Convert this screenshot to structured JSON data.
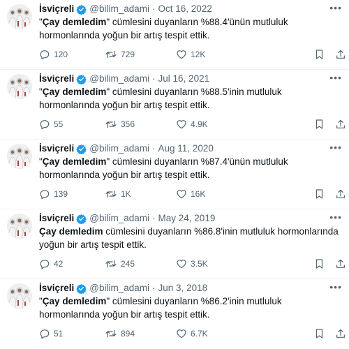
{
  "tweets": [
    {
      "author": "İsviçreli",
      "handle": "@bilim_adami",
      "separator": "·",
      "date": "Oct 16, 2022",
      "text": {
        "open_quote": "\"",
        "bold": "Çay demledim",
        "close_quote": "\"",
        "rest": " cümlesini duyanların %88.4'ünün mutluluk hormonlarında yoğun bir artış tespit ettik."
      },
      "replies": "120",
      "retweets": "729",
      "likes": "12K"
    },
    {
      "author": "İsviçreli",
      "handle": "@bilim_adami",
      "separator": "·",
      "date": "Jul 16, 2021",
      "text": {
        "open_quote": "\"",
        "bold": "Çay demledim",
        "close_quote": "\"",
        "rest": " cümlesini duyanların %88.5'inin mutluluk hormonlarında yoğun bir artış tespit ettik."
      },
      "replies": "55",
      "retweets": "356",
      "likes": "4.9K"
    },
    {
      "author": "İsviçreli",
      "handle": "@bilim_adami",
      "separator": "·",
      "date": "Aug 11, 2020",
      "text": {
        "open_quote": "\"",
        "bold": "Çay demledim",
        "close_quote": "\"",
        "rest": " cümlesini duyanların %87.4'ünün mutluluk hormonlarında yoğun bir artış tespit ettik."
      },
      "replies": "139",
      "retweets": "1K",
      "likes": "16K"
    },
    {
      "author": "İsviçreli",
      "handle": "@bilim_adami",
      "separator": "·",
      "date": "May 24, 2019",
      "text": {
        "open_quote": "",
        "bold": "Çay demledim",
        "close_quote": "",
        "rest": " cümlesini duyanların %86.8'inin mutluluk hormonlarında yoğun bir artış tespit ettik."
      },
      "replies": "42",
      "retweets": "245",
      "likes": "3.5K"
    },
    {
      "author": "İsviçreli",
      "handle": "@bilim_adami",
      "separator": "·",
      "date": "Jun 3, 2018",
      "text": {
        "open_quote": "\"",
        "bold": "Çay demledim",
        "close_quote": "\"",
        "rest": " cümlesini duyanların %86.2'inin mutluluk hormonlarında yoğun bir artış tespit ettik."
      },
      "replies": "51",
      "retweets": "894",
      "likes": "6.7K"
    }
  ],
  "icons": {
    "verified": "verified-badge-icon",
    "more": "more-options-icon",
    "reply": "reply-icon",
    "retweet": "retweet-icon",
    "like": "heart-icon",
    "bookmark": "bookmark-icon",
    "share": "share-icon"
  },
  "colors": {
    "verified": "#1d9bf0",
    "text": "#0f1419",
    "secondary": "#536471",
    "divider": "#eff3f4"
  }
}
